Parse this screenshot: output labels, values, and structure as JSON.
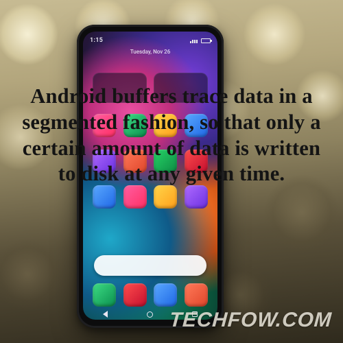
{
  "overlay": {
    "main_text": "Android buffers trace data in a segmented fashion, so that only a certain amount of data is written to disk at any given time."
  },
  "watermark": {
    "text": "TECHFOW.COM"
  },
  "phone": {
    "status": {
      "time": "1:15",
      "date": "Tuesday, Nov 26"
    }
  }
}
